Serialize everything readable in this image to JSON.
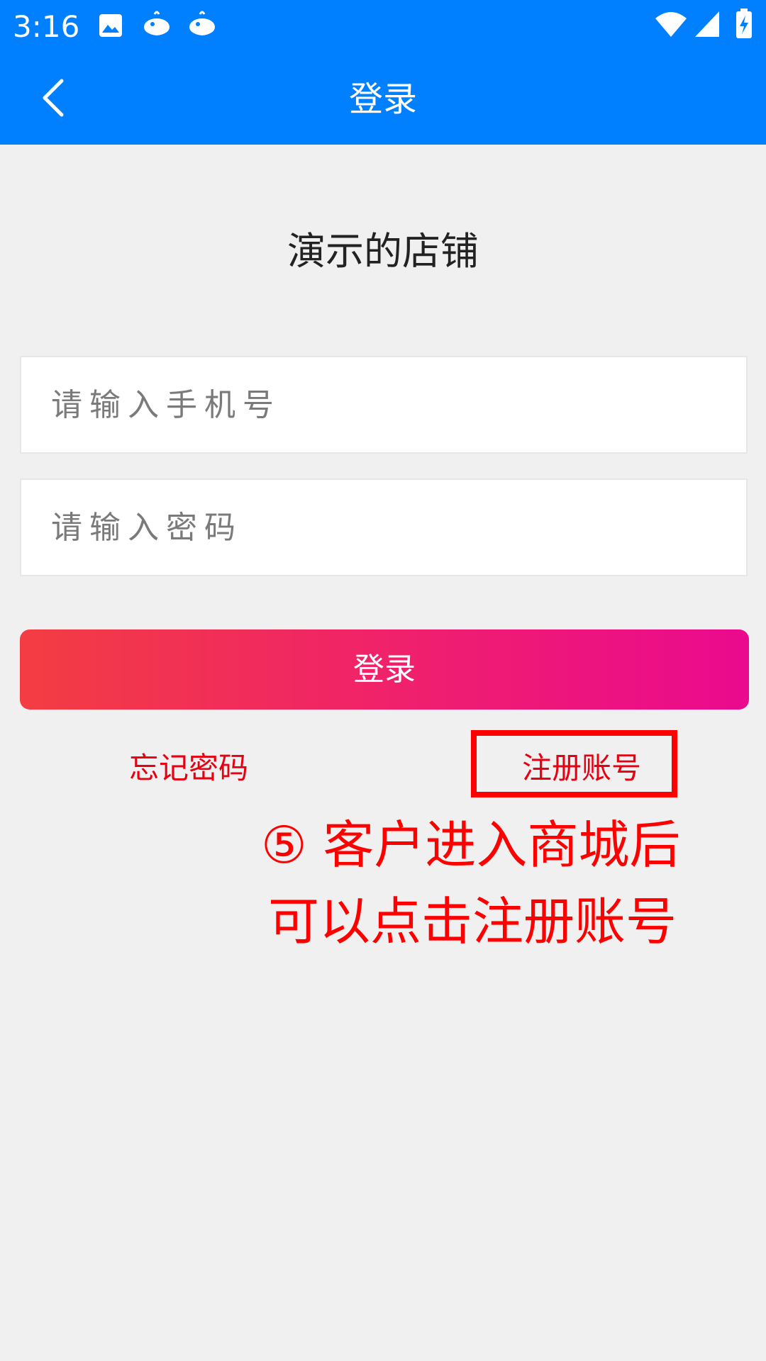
{
  "status_bar": {
    "time": "3:16",
    "left_icons": [
      "image-icon",
      "whale-app-icon",
      "whale-app-icon"
    ],
    "right_icons": [
      "wifi-icon",
      "cell-signal-icon",
      "battery-charging-icon"
    ]
  },
  "app_bar": {
    "title": "登录",
    "back_icon": "chevron-left-icon",
    "color": "#0080ff"
  },
  "shop_name": "演示的店铺",
  "form": {
    "phone_placeholder": "请输入手机号",
    "phone_value": "",
    "password_placeholder": "请输入密码",
    "password_value": "",
    "login_label": "登录",
    "forgot_password_label": "忘记密码",
    "register_label": "注册账号"
  },
  "annotation": {
    "line1": "⑤ 客户进入商城后",
    "line2": "可以点击注册账号",
    "color": "#ff0000"
  }
}
